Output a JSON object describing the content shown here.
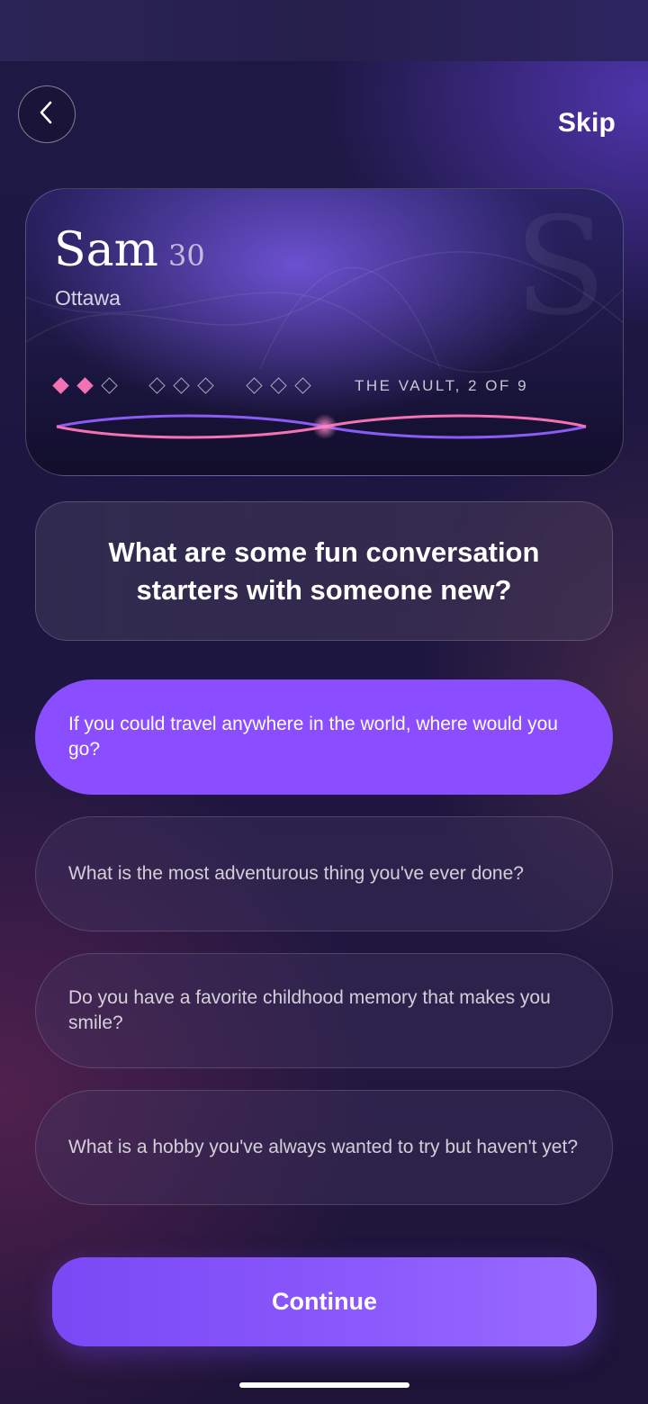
{
  "header": {
    "back_icon": "chevron-left-icon",
    "skip_label": "Skip"
  },
  "profile": {
    "name": "Sam",
    "age": "30",
    "city": "Ottawa",
    "watermark": "S",
    "progress_label": "THE VAULT, 2 OF 9",
    "progress": {
      "completed": 2,
      "total": 9
    },
    "accent_color": "#f272b4",
    "wave_colors": [
      "#f272b4",
      "#8a5cf6"
    ]
  },
  "question": "What are some fun conversation starters with someone new?",
  "options": [
    {
      "text": "If you could travel anywhere in the world, where would you go?",
      "selected": true
    },
    {
      "text": "What is the most adventurous thing you've ever done?",
      "selected": false
    },
    {
      "text": "Do you have a favorite childhood memory that makes you smile?",
      "selected": false
    },
    {
      "text": "What is a hobby you've always wanted to try but haven't yet?",
      "selected": false
    }
  ],
  "continue_label": "Continue",
  "colors": {
    "primary": "#8a4dff",
    "background": "#1c1640"
  }
}
